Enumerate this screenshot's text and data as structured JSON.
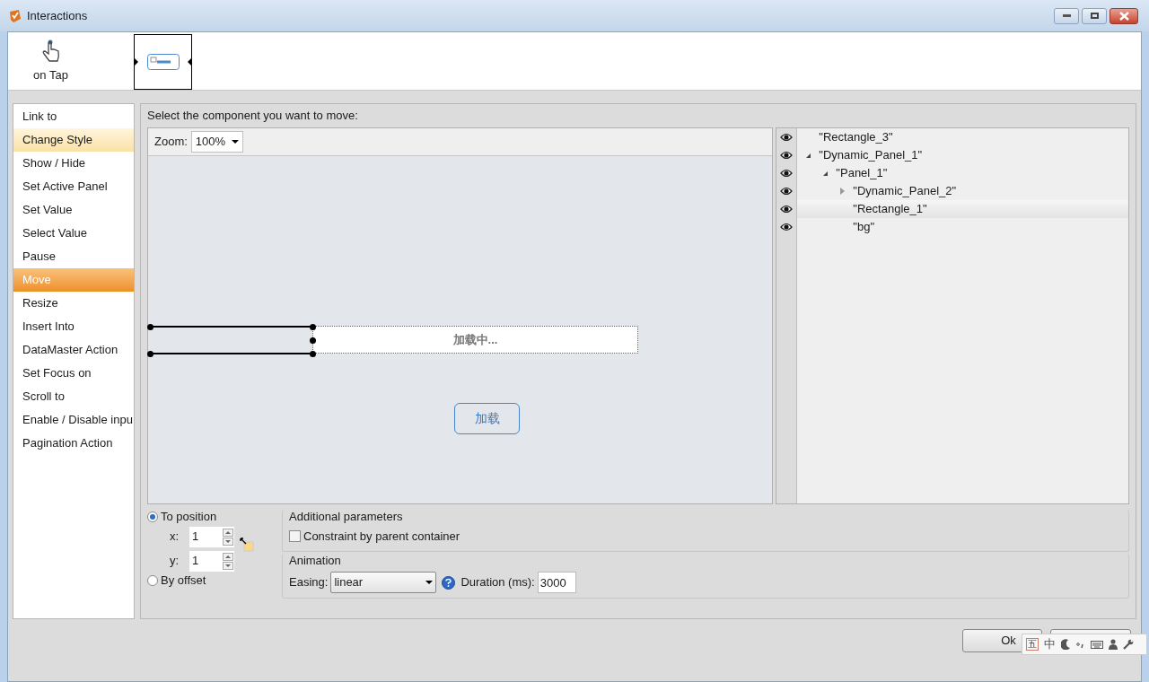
{
  "window": {
    "title": "Interactions"
  },
  "trigger": {
    "label": "on Tap"
  },
  "actions": [
    {
      "label": "Link to",
      "selected": false,
      "highlighted": false
    },
    {
      "label": "Change Style",
      "selected": false,
      "highlighted": true
    },
    {
      "label": "Show / Hide",
      "selected": false,
      "highlighted": false
    },
    {
      "label": "Set Active Panel",
      "selected": false,
      "highlighted": false
    },
    {
      "label": "Set Value",
      "selected": false,
      "highlighted": false
    },
    {
      "label": "Select Value",
      "selected": false,
      "highlighted": false
    },
    {
      "label": "Pause",
      "selected": false,
      "highlighted": false
    },
    {
      "label": "Move",
      "selected": true,
      "highlighted": false
    },
    {
      "label": "Resize",
      "selected": false,
      "highlighted": false
    },
    {
      "label": "Insert Into",
      "selected": false,
      "highlighted": false
    },
    {
      "label": "DataMaster Action",
      "selected": false,
      "highlighted": false
    },
    {
      "label": "Set Focus on",
      "selected": false,
      "highlighted": false
    },
    {
      "label": "Scroll to",
      "selected": false,
      "highlighted": false
    },
    {
      "label": "Enable / Disable inpu",
      "selected": false,
      "highlighted": false
    },
    {
      "label": "Pagination Action",
      "selected": false,
      "highlighted": false
    }
  ],
  "instruction": "Select the component you want to move:",
  "zoom": {
    "label": "Zoom:",
    "value": "100%"
  },
  "canvas": {
    "loading_text": "加载中...",
    "button_label": "加载"
  },
  "tree": [
    {
      "label": "\"Rectangle_3\"",
      "visible": true,
      "selected": false
    },
    {
      "label": "\"Dynamic_Panel_1\"",
      "visible": true,
      "selected": false,
      "expanded": true,
      "children": [
        {
          "label": "\"Panel_1\"",
          "visible": true,
          "selected": false,
          "expanded": true,
          "children": [
            {
              "label": "\"Dynamic_Panel_2\"",
              "visible": true,
              "selected": false,
              "expanded": false
            },
            {
              "label": "\"Rectangle_1\"",
              "visible": true,
              "selected": true
            },
            {
              "label": "\"bg\"",
              "visible": true,
              "selected": false
            }
          ]
        }
      ]
    }
  ],
  "position": {
    "modes": [
      {
        "label": "To position",
        "selected": true
      },
      {
        "label": "By offset",
        "selected": false
      }
    ],
    "x": {
      "label": "x:",
      "value": "1"
    },
    "y": {
      "label": "y:",
      "value": "1"
    }
  },
  "additional": {
    "title": "Additional parameters",
    "checkbox": {
      "label": "Constraint by parent container",
      "checked": false
    }
  },
  "animation": {
    "title": "Animation",
    "easing_label": "Easing:",
    "easing": "linear",
    "duration_label": "Duration (ms):",
    "duration": "3000"
  },
  "ok_button": "Ok",
  "ime": {
    "mode": "五",
    "lang": "中"
  }
}
